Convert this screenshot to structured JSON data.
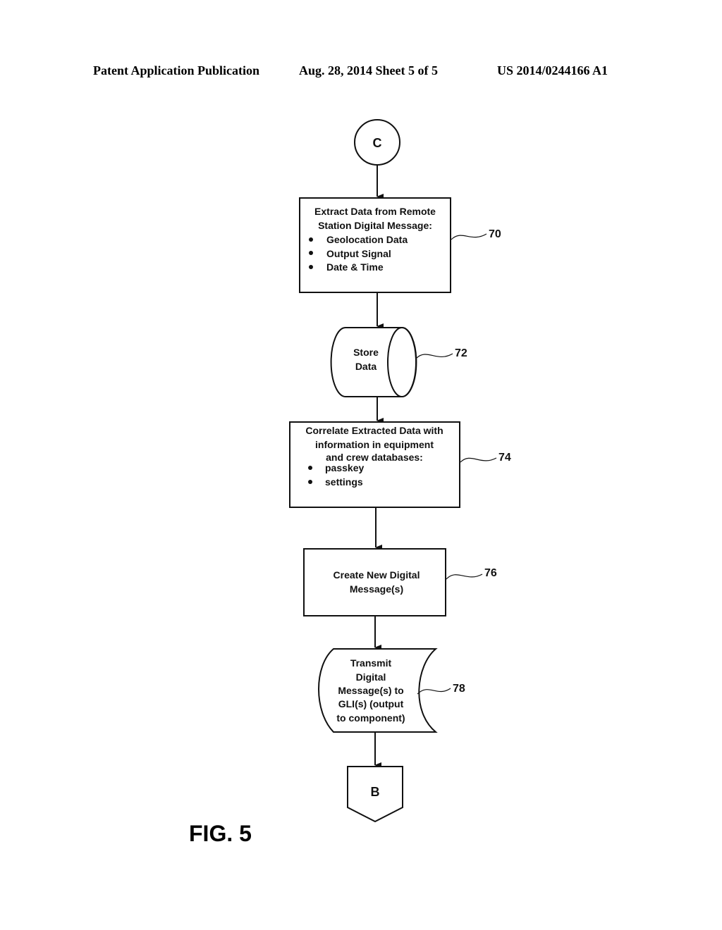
{
  "header": {
    "left": "Patent Application Publication",
    "middle": "Aug. 28, 2014  Sheet 5 of 5",
    "right": "US 2014/0244166 A1"
  },
  "figure_label": "FIG. 5",
  "connector_top": {
    "label": "C"
  },
  "connector_bottom": {
    "label": "B"
  },
  "steps": [
    {
      "ref": "70",
      "title_lines": [
        "Extract Data from Remote",
        "Station Digital Message:"
      ],
      "bullets": [
        "Geolocation Data",
        "Output Signal",
        "Date & Time"
      ]
    },
    {
      "ref": "72",
      "lines": [
        "Store",
        "Data"
      ]
    },
    {
      "ref": "74",
      "title_lines": [
        "Correlate Extracted Data with",
        "information in equipment",
        "and crew databases:"
      ],
      "bullets": [
        "passkey",
        "settings"
      ]
    },
    {
      "ref": "76",
      "lines": [
        "Create New Digital",
        "Message(s)"
      ]
    },
    {
      "ref": "78",
      "lines": [
        "Transmit",
        "Digital",
        "Message(s) to",
        "GLI(s) (output",
        "to component)"
      ]
    }
  ]
}
